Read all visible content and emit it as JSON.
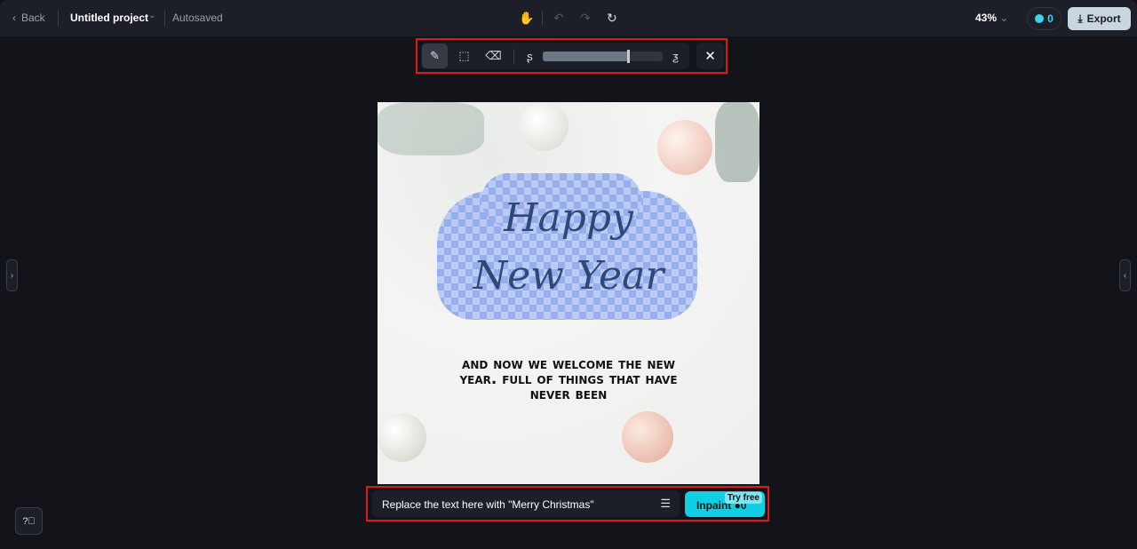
{
  "header": {
    "back_label": "Back",
    "project_title": "Untitled project",
    "save_status": "Autosaved",
    "zoom_level": "43%",
    "credits": "0",
    "export_label": "Export"
  },
  "toolbar": {
    "tools": [
      "brush-icon",
      "select-icon",
      "eraser-icon",
      "brush-size-icon"
    ],
    "brush_size_percent": 72
  },
  "canvas": {
    "heading_line1": "Happy",
    "heading_line2": "New Year",
    "body": "And now we welcome the new year. Full of things that have never been"
  },
  "prompt": {
    "value": "Replace the text here with \"Merry Christmas\"",
    "inpaint_label": "Inpaint",
    "inpaint_cost": "0",
    "badge": "Try free"
  },
  "colors": {
    "accent": "#0ecfe4",
    "highlight": "#e0161e",
    "mask": "#8da8ec"
  }
}
